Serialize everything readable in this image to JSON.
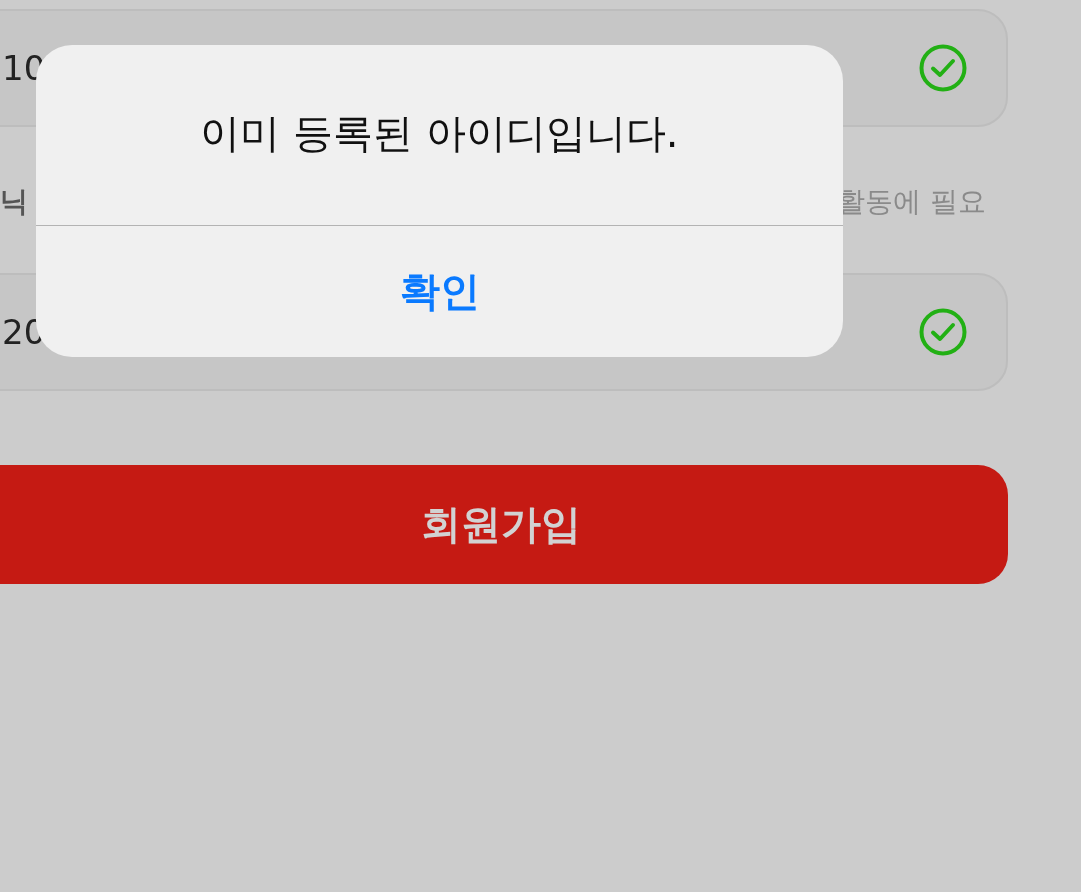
{
  "rows": [
    {
      "kind": "field",
      "value": "10",
      "valid": true
    },
    {
      "kind": "label",
      "label": "닉",
      "hint": "활동에 필요"
    },
    {
      "kind": "field",
      "value": "20",
      "valid": true
    }
  ],
  "submit_button": "회원가입",
  "alert": {
    "message": "이미 등록된 아이디입니다.",
    "button": "확인"
  }
}
